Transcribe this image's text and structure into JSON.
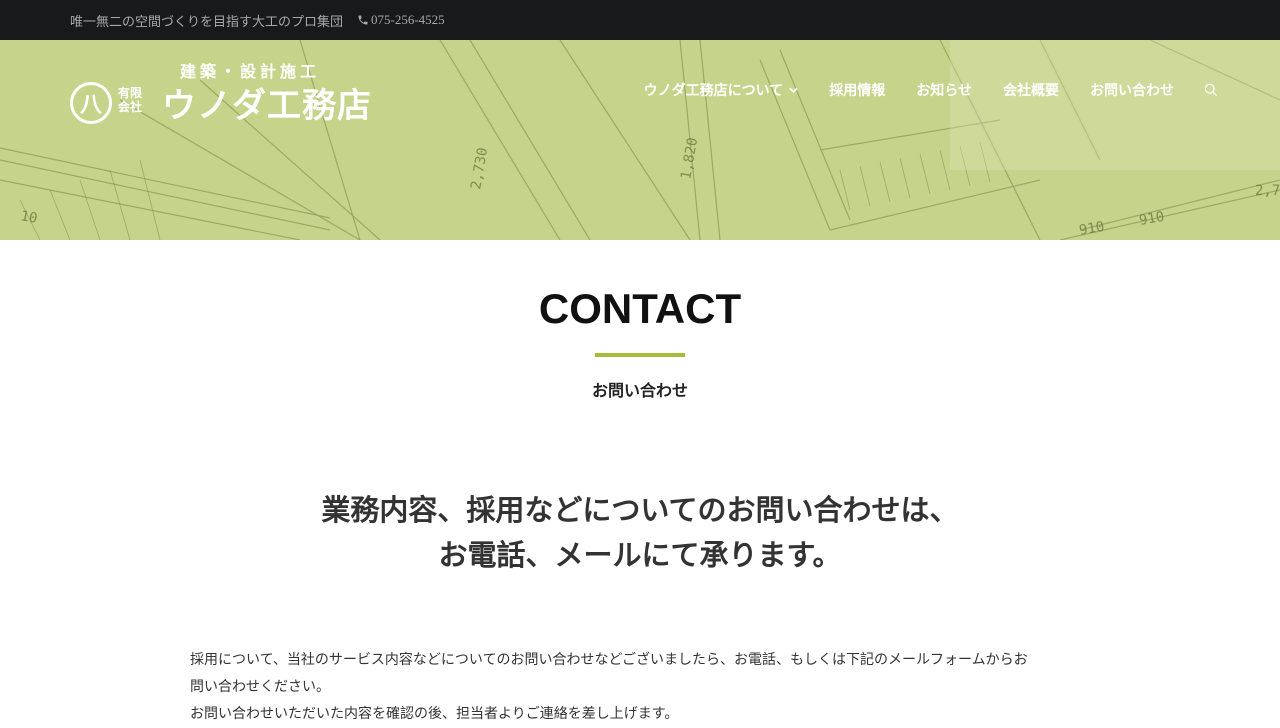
{
  "topbar": {
    "tagline": "唯一無二の空間づくりを目指す大工のプロ集団",
    "phone": "075-256-4525"
  },
  "logo": {
    "subtitle": "建築・設計施工",
    "mark": "八",
    "small_line1": "有限",
    "small_line2": "会社",
    "company_name": "ウノダ工務店"
  },
  "nav": {
    "items": [
      {
        "label": "ウノダ工務店について",
        "has_dropdown": true
      },
      {
        "label": "採用情報"
      },
      {
        "label": "お知らせ"
      },
      {
        "label": "会社概要"
      },
      {
        "label": "お問い合わせ"
      }
    ],
    "search_icon": "search-icon"
  },
  "section": {
    "title": "CONTACT",
    "subtitle": "お問い合わせ"
  },
  "headline": {
    "line1": "業務内容、採用などについてのお問い合わせは、",
    "line2": "お電話、メールにて承ります。"
  },
  "body": {
    "paragraph1_line1": "採用について、当社のサービス内容などについてのお問い合わせなどございましたら、お電話、もしくは下記のメールフォームからお",
    "paragraph1_line2": "問い合わせください。",
    "paragraph2": "お問い合わせいただいた内容を確認の後、担当者よりご連絡を差し上げます。"
  },
  "colors": {
    "topbar_bg": "#18191b",
    "hero_tint": "#c6d38a",
    "accent": "#a7bd3a"
  }
}
